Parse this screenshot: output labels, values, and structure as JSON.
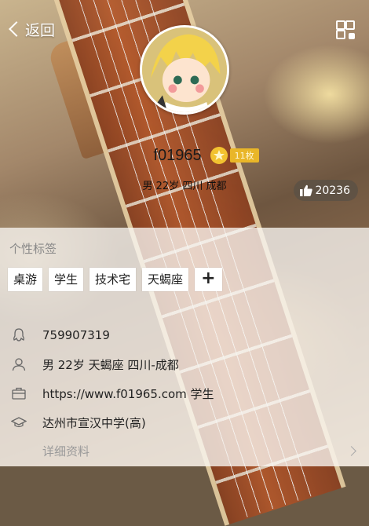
{
  "header": {
    "back_label": "返回"
  },
  "profile": {
    "name": "f01965",
    "level_badge": "11枚",
    "summary": "男 22岁 四川 成都",
    "likes": "20236"
  },
  "tags": {
    "title": "个性标签",
    "items": [
      "桌游",
      "学生",
      "技术宅",
      "天蝎座"
    ],
    "add_label": "+"
  },
  "info": {
    "qq": "759907319",
    "basic": "男  22岁  天蝎座  四川-成都",
    "website": "https://www.f01965.com 学生",
    "school": "达州市宣汉中学(高)",
    "more_label": "详细资料"
  },
  "colors": {
    "level_badge": "#e9b628",
    "like_pill": "#5a5046"
  }
}
